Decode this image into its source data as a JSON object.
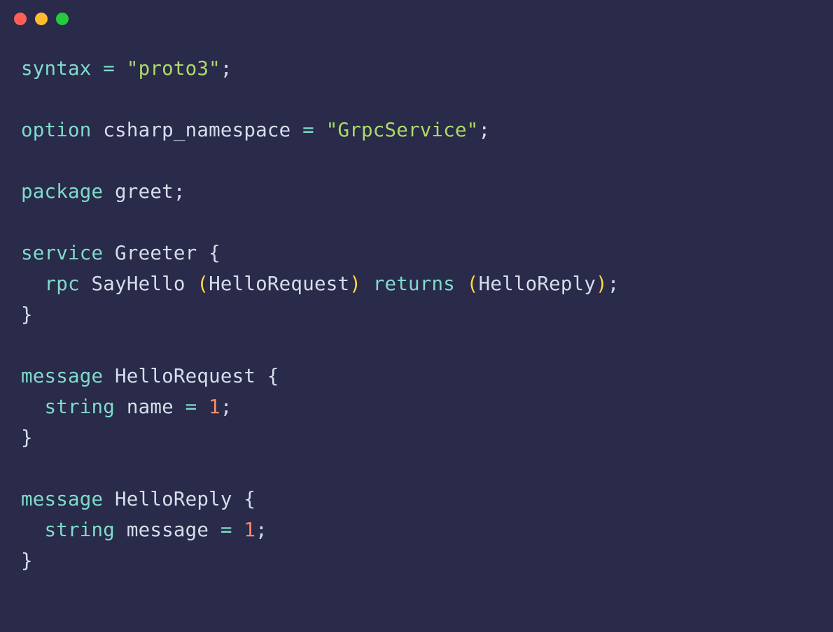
{
  "colors": {
    "background": "#2a2a4a",
    "traffic_red": "#ff5f56",
    "traffic_yellow": "#ffbd2e",
    "traffic_green": "#27c93f",
    "keyword": "#7fdbca",
    "identifier": "#d6deeb",
    "operator": "#7fdbca",
    "string": "#addb67",
    "punctuation": "#d6deeb",
    "paren": "#ffd93d",
    "number": "#f78c6c"
  },
  "code": {
    "line1": {
      "kw": "syntax",
      "op": " = ",
      "str": "\"proto3\"",
      "punc": ";"
    },
    "line2": "",
    "line3": {
      "kw": "option",
      "ident": " csharp_namespace ",
      "op": "= ",
      "str": "\"GrpcService\"",
      "punc": ";"
    },
    "line4": "",
    "line5": {
      "kw": "package",
      "ident": " greet",
      "punc": ";"
    },
    "line6": "",
    "line7": {
      "kw": "service",
      "ident": " Greeter ",
      "brace": "{"
    },
    "line8": {
      "indent": "  ",
      "kw": "rpc",
      "ident1": " SayHello ",
      "lp1": "(",
      "arg1": "HelloRequest",
      "rp1": ")",
      "kw2": " returns ",
      "lp2": "(",
      "arg2": "HelloReply",
      "rp2": ")",
      "punc": ";"
    },
    "line9": {
      "brace": "}"
    },
    "line10": "",
    "line11": {
      "kw": "message",
      "ident": " HelloRequest ",
      "brace": "{"
    },
    "line12": {
      "indent": "  ",
      "kw": "string",
      "ident": " name ",
      "op": "= ",
      "num": "1",
      "punc": ";"
    },
    "line13": {
      "brace": "}"
    },
    "line14": "",
    "line15": {
      "kw": "message",
      "ident": " HelloReply ",
      "brace": "{"
    },
    "line16": {
      "indent": "  ",
      "kw": "string",
      "ident": " message ",
      "op": "= ",
      "num": "1",
      "punc": ";"
    },
    "line17": {
      "brace": "}"
    }
  }
}
